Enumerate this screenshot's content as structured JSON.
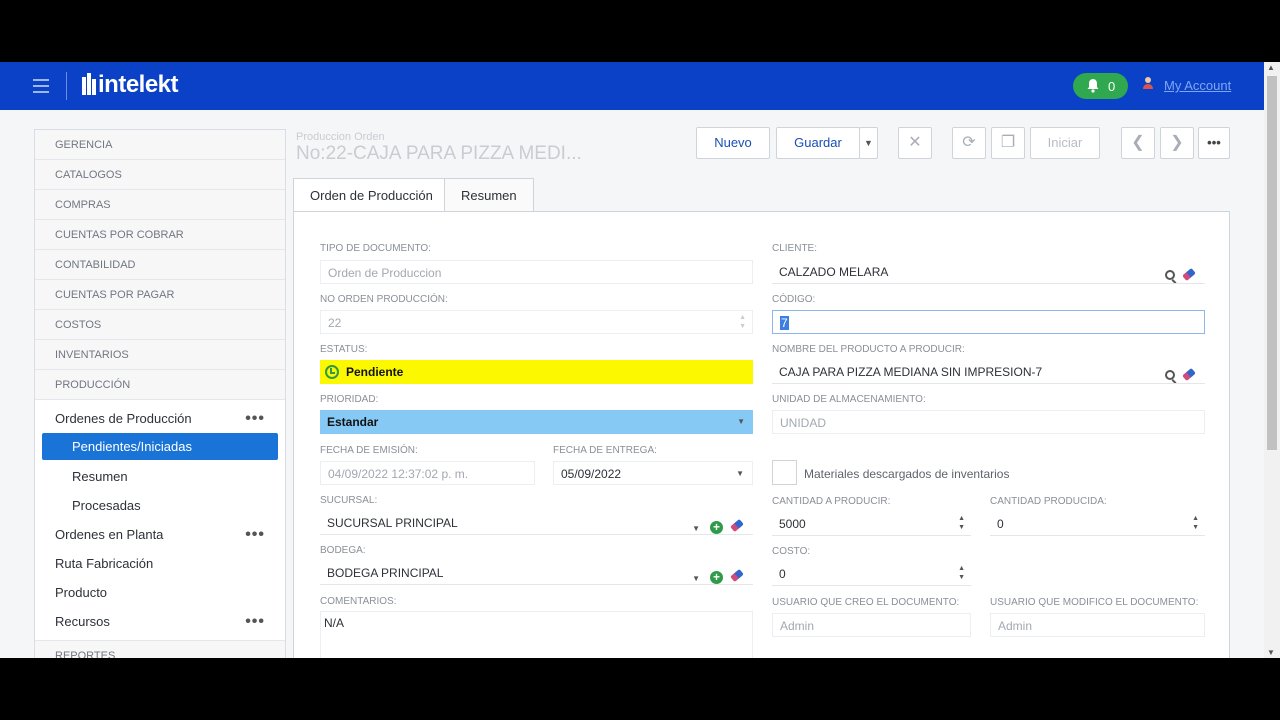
{
  "header": {
    "brand": "intelekt",
    "notifications_count": "0",
    "account_label": "My Account"
  },
  "sidebar": {
    "sections_top": [
      "GERENCIA",
      "CATALOGOS",
      "COMPRAS",
      "CUENTAS POR COBRAR",
      "CONTABILIDAD",
      "CUENTAS POR PAGAR",
      "COSTOS",
      "INVENTARIOS",
      "PRODUCCIÓN"
    ],
    "ordenes_produccion": "Ordenes de Producción",
    "pendientes": "Pendientes/Iniciadas",
    "resumen": "Resumen",
    "procesadas": "Procesadas",
    "ordenes_planta": "Ordenes en Planta",
    "ruta": "Ruta Fabricación",
    "producto": "Producto",
    "recursos": "Recursos",
    "reportes": "REPORTES"
  },
  "page": {
    "subtitle": "Produccion Orden",
    "title": "No:22-CAJA PARA PIZZA MEDI..."
  },
  "toolbar": {
    "nuevo": "Nuevo",
    "guardar": "Guardar",
    "iniciar": "Iniciar"
  },
  "tabs": {
    "orden": "Orden de Producción",
    "resumen": "Resumen"
  },
  "form": {
    "tipo_documento_label": "TIPO DE DOCUMENTO:",
    "tipo_documento": "Orden de Produccion",
    "no_orden_label": "NO ORDEN PRODUCCIÓN:",
    "no_orden": "22",
    "estatus_label": "ESTATUS:",
    "estatus": "Pendiente",
    "prioridad_label": "PRIORIDAD:",
    "prioridad": "Estandar",
    "fecha_emision_label": "FECHA DE EMISIÓN:",
    "fecha_emision": "04/09/2022 12:37:02 p. m.",
    "fecha_entrega_label": "FECHA DE ENTREGA:",
    "fecha_entrega": "05/09/2022",
    "sucursal_label": "SUCURSAL:",
    "sucursal": "SUCURSAL PRINCIPAL",
    "bodega_label": "BODEGA:",
    "bodega": "BODEGA PRINCIPAL",
    "comentarios_label": "COMENTARIOS:",
    "comentarios": "N/A",
    "cliente_label": "CLIENTE:",
    "cliente": "CALZADO MELARA",
    "codigo_label": "CÓDIGO:",
    "codigo": "7",
    "producto_label": "NOMBRE DEL PRODUCTO A PRODUCIR:",
    "producto": "CAJA PARA PIZZA MEDIANA SIN IMPRESION-7",
    "unidad_label": "UNIDAD DE ALMACENAMIENTO:",
    "unidad": "UNIDAD",
    "materiales_label": "Materiales descargados de inventarios",
    "cantidad_producir_label": "CANTIDAD A PRODUCIR:",
    "cantidad_producir": "5000",
    "cantidad_producida_label": "CANTIDAD PRODUCIDA:",
    "cantidad_producida": "0",
    "costo_label": "COSTO:",
    "costo": "0",
    "usuario_creo_label": "USUARIO QUE CREO EL DOCUMENTO:",
    "usuario_creo": "Admin",
    "usuario_modifico_label": "USUARIO QUE MODIFICO EL DOCUMENTO:",
    "usuario_modifico": "Admin"
  },
  "colors": {
    "header": "#0a41c6",
    "status_pending": "#fbf800",
    "priority": "#87c9f5",
    "active_nav": "#1a73d6",
    "bell": "#2fa84f"
  }
}
